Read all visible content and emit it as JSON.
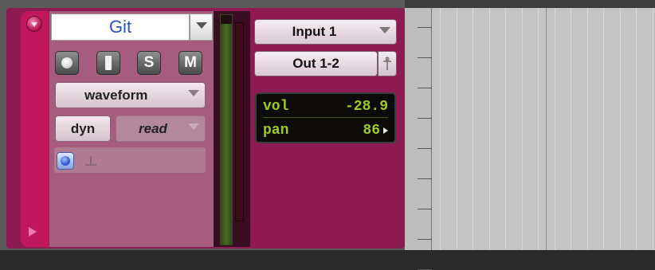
{
  "track": {
    "name": "Git",
    "colors": {
      "track": "#c0175e",
      "panel": "#8e1a52",
      "name_text": "#2b52c4",
      "lcd_text": "#9ecb26"
    },
    "buttons": {
      "solo": "S",
      "mute": "M",
      "input": "I"
    },
    "view": "waveform",
    "automation": {
      "dyn": "dyn",
      "mode": "read"
    },
    "io": {
      "input": "Input 1",
      "output": "Out 1-2"
    },
    "lcd": {
      "vol_label": "vol",
      "vol_value": "-28.9",
      "pan_label": "pan",
      "pan_value": "86"
    },
    "icons": {
      "collapse": "collapse-icon",
      "expand": "expand-triangle-icon",
      "record": "record-enable-icon",
      "monitor": "input-monitor-icon",
      "pin": "pin-icon"
    }
  }
}
